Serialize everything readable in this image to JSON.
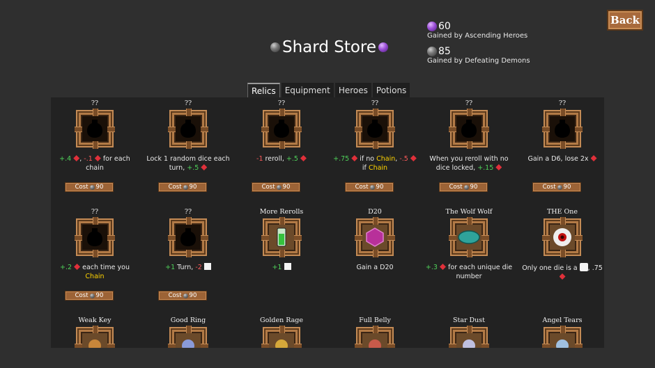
{
  "back_label": "Back",
  "title": "Shard Store",
  "currency": [
    {
      "amount": "60",
      "label": "Gained by Ascending Heroes",
      "orb": "purple"
    },
    {
      "amount": "85",
      "label": "Gained by Defeating Demons",
      "orb": "grey"
    }
  ],
  "tabs": [
    "Relics",
    "Equipment",
    "Heroes",
    "Potions"
  ],
  "cost_prefix": "Cost",
  "cost_value": "90",
  "relics": [
    {
      "name": "??",
      "icon": "urn-silhouette",
      "desc_html": "<span class='g'>+.4</span> <span class='gem'></span>, <span class='r'>-.1</span> <span class='gem'></span> for each chain",
      "cost": true
    },
    {
      "name": "??",
      "icon": "bottle-silhouette",
      "desc_html": "Lock 1 random dice each turn, <span class='g'>+.5</span> <span class='gem'></span>",
      "cost": true
    },
    {
      "name": "??",
      "icon": "flask-silhouette",
      "desc_html": "<span class='r'>-1</span> reroll, <span class='g'>+.5</span> <span class='gem'></span>",
      "cost": true
    },
    {
      "name": "??",
      "icon": "pot-silhouette",
      "desc_html": "<span class='g'>+.75</span> <span class='gem'></span> if no <span class='y'>Chain</span>, <span class='r'>-.5</span> <span class='gem'></span> if <span class='y'>Chain</span>",
      "cost": true
    },
    {
      "name": "??",
      "icon": "hand-silhouette",
      "desc_html": "When you reroll with no dice locked, <span class='g'>+.15</span> <span class='gem'></span>",
      "cost": true
    },
    {
      "name": "??",
      "icon": "potion-silhouette",
      "desc_html": "Gain a D6, lose 2x <span class='gem'></span>",
      "cost": true
    },
    {
      "name": "??",
      "icon": "bird-silhouette",
      "desc_html": "<span class='g'>+.2</span> <span class='gem'></span> each time you <span class='y'>Chain</span>",
      "cost": true
    },
    {
      "name": "??",
      "icon": "ghost-silhouette",
      "desc_html": "<span class='g'>+1</span> Turn, <span class='r'>-2</span> <span class='chk'></span>",
      "cost": true
    },
    {
      "name": "More Rerolls",
      "icon": "green-potion-icon",
      "desc_html": "<span class='g'>+1</span> <span class='chk'></span>",
      "cost": false
    },
    {
      "name": "D20",
      "icon": "d20-icon",
      "desc_html": "Gain a D20",
      "cost": false
    },
    {
      "name": "The Wolf Wolf",
      "icon": "wolf-icon",
      "desc_html": "<span class='g'>+.3</span> <span class='gem'></span> for each unique die number",
      "cost": false
    },
    {
      "name": "THE One",
      "icon": "eye-icon",
      "desc_html": "Only one die is a <span class='die'></span>, .75 <span class='gem'></span>",
      "cost": false
    },
    {
      "name": "Weak Key",
      "icon": "key-icon",
      "desc_html": "",
      "cost": false
    },
    {
      "name": "Good Ring",
      "icon": "ring-icon",
      "desc_html": "",
      "cost": false
    },
    {
      "name": "Golden Rage",
      "icon": "golden-rage-icon",
      "desc_html": "",
      "cost": false
    },
    {
      "name": "Full Belly",
      "icon": "full-belly-icon",
      "desc_html": "",
      "cost": false
    },
    {
      "name": "Star Dust",
      "icon": "star-dust-icon",
      "desc_html": "",
      "cost": false
    },
    {
      "name": "Angel Tears",
      "icon": "angel-tears-icon",
      "desc_html": "",
      "cost": false
    }
  ]
}
